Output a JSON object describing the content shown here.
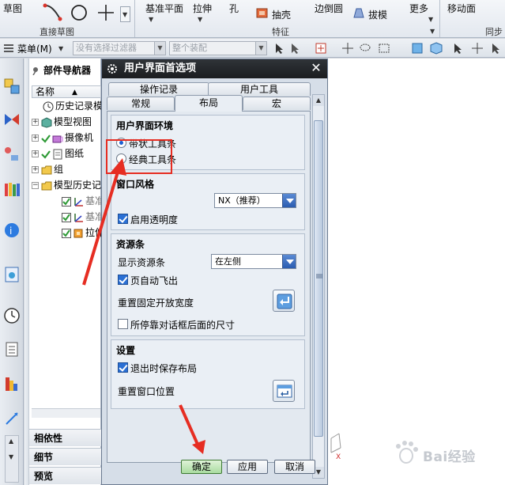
{
  "ribbon": {
    "sketch_label": "草图",
    "direct_sketch_label": "直接草图",
    "datum_plane_label": "基准平面",
    "extrude_label": "拉伸",
    "hole_label": "孔",
    "shell_label": "抽壳",
    "edge_blend_label": "边倒圆",
    "draft_label": "拔模",
    "more_label": "更多",
    "feature_label": "特征",
    "move_face_label": "移动面",
    "sync_label": "同步"
  },
  "toolbar": {
    "menu_label": "菜单(M)",
    "filter_placeholder": "没有选择过滤器",
    "assembly_placeholder": "整个装配"
  },
  "navigator": {
    "title": "部件导航器",
    "column_name": "名称",
    "items": [
      {
        "label": "历史记录模式"
      },
      {
        "label": "模型视图"
      },
      {
        "label": "摄像机"
      },
      {
        "label": "图纸"
      },
      {
        "label": "组"
      },
      {
        "label": "模型历史记录"
      },
      {
        "label": "基准坐标系"
      },
      {
        "label": "基准平面"
      },
      {
        "label": "拉伸"
      }
    ],
    "sections": {
      "dependencies": "相依性",
      "details": "细节",
      "preview": "预览"
    }
  },
  "dialog": {
    "title": "用户界面首选项",
    "tabs_back": [
      "操作记录",
      "用户工具"
    ],
    "tabs_front": [
      "常规",
      "布局",
      "宏"
    ],
    "active_tab": "布局",
    "groups": {
      "ui_env": {
        "title": "用户界面环境",
        "ribbon_option": "带状工具条",
        "classic_option": "经典工具条",
        "selected": "ribbon"
      },
      "window_style": {
        "title": "窗口风格",
        "style_value": "NX（推荐）",
        "transparency_label": "启用透明度",
        "transparency_checked": true
      },
      "resource_bar": {
        "title": "资源条",
        "display_label": "显示资源条",
        "display_value": "在左侧",
        "autofly_label": "页自动飞出",
        "autofly_checked": true,
        "reset_width_label": "重置固定开放宽度",
        "docked_size_label": "所停靠对话框后面的尺寸",
        "docked_size_checked": false
      },
      "settings": {
        "title": "设置",
        "save_on_exit_label": "退出时保存布局",
        "save_on_exit_checked": true,
        "reset_position_label": "重置窗口位置"
      }
    },
    "buttons": {
      "ok": "确定",
      "apply": "应用",
      "cancel": "取消"
    }
  },
  "watermark": {
    "text": "Bai经验"
  },
  "colors": {
    "accent_red": "#e62d22",
    "title_bar": "#1f2226",
    "select_blue": "#2b5cb0"
  }
}
